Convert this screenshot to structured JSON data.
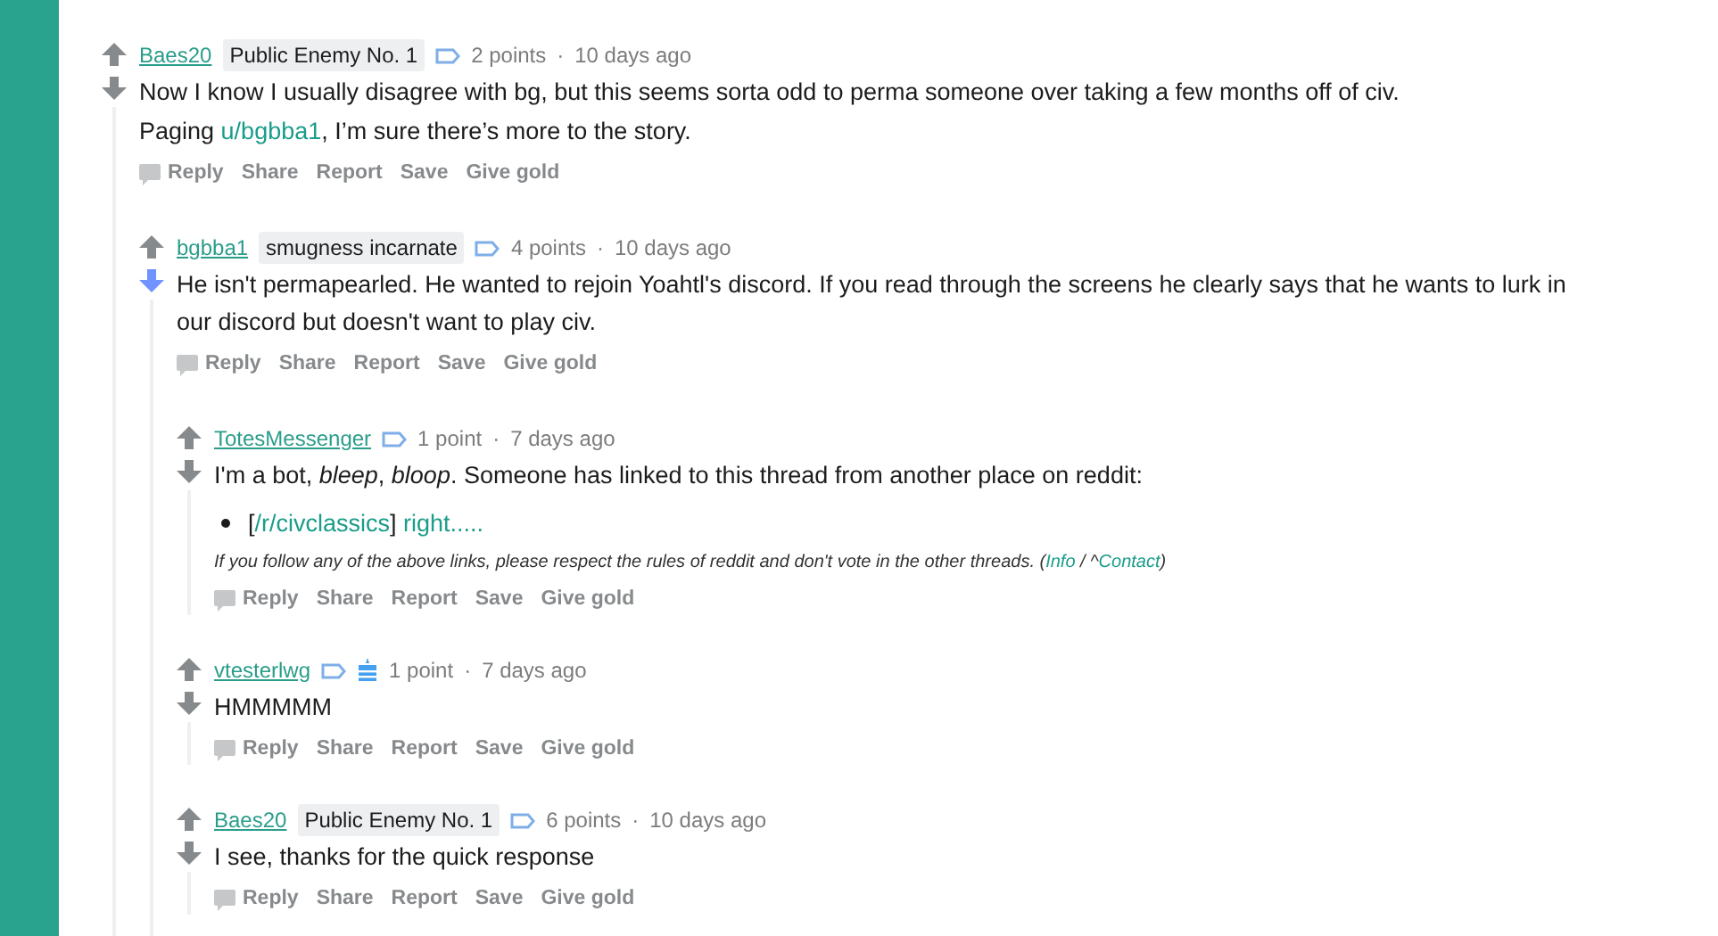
{
  "comments": [
    {
      "author": "Baes20",
      "flair": "Public Enemy No. 1",
      "points": "2 points",
      "separator": "·",
      "time": "10 days ago",
      "upvoted": false,
      "downvoted": false,
      "cake_day": false,
      "body": [
        {
          "kind": "paragraph",
          "parts": [
            {
              "kind": "text",
              "text": "Now I know I usually disagree with bg, but this seems sorta odd to perma someone over taking a few months off of civ."
            }
          ]
        },
        {
          "kind": "paragraph",
          "parts": [
            {
              "kind": "text",
              "text": "Paging "
            },
            {
              "kind": "link",
              "text": "u/bgbba1"
            },
            {
              "kind": "text",
              "text": ", I’m sure there’s more to the story."
            }
          ]
        }
      ],
      "actions": [
        "Reply",
        "Share",
        "Report",
        "Save",
        "Give gold"
      ],
      "children": [
        {
          "author": "bgbba1",
          "flair": "smugness incarnate",
          "points": "4 points",
          "separator": "·",
          "time": "10 days ago",
          "upvoted": false,
          "downvoted": true,
          "cake_day": false,
          "body": [
            {
              "kind": "paragraph",
              "parts": [
                {
                  "kind": "text",
                  "text": "He isn't permapearled. He wanted to rejoin Yoahtl's discord. If you read through the screens he clearly says that he wants to lurk in our discord but doesn't want to play civ."
                }
              ]
            }
          ],
          "actions": [
            "Reply",
            "Share",
            "Report",
            "Save",
            "Give gold"
          ],
          "children": [
            {
              "author": "TotesMessenger",
              "points": "1 point",
              "separator": "·",
              "time": "7 days ago",
              "upvoted": false,
              "downvoted": false,
              "cake_day": false,
              "body": [
                {
                  "kind": "paragraph",
                  "parts": [
                    {
                      "kind": "text",
                      "text": "I'm a bot, *bleep*, *bloop*. Someone has linked to this thread from another place on reddit:"
                    }
                  ]
                },
                {
                  "kind": "bullet",
                  "parts": [
                    {
                      "kind": "text",
                      "text": "["
                    },
                    {
                      "kind": "link",
                      "text": "/r/civclassics"
                    },
                    {
                      "kind": "text",
                      "text": "] "
                    },
                    {
                      "kind": "link",
                      "text": "right....."
                    }
                  ]
                },
                {
                  "kind": "footnote",
                  "parts": [
                    {
                      "kind": "text",
                      "text": "If you follow any of the above links, please respect the rules of reddit and don't vote in the other threads. ("
                    },
                    {
                      "kind": "link",
                      "text": "Info"
                    },
                    {
                      "kind": "text",
                      "text": " / ^"
                    },
                    {
                      "kind": "biglink",
                      "text": "Contact"
                    },
                    {
                      "kind": "text",
                      "text": ")"
                    }
                  ]
                }
              ],
              "actions": [
                "Reply",
                "Share",
                "Report",
                "Save",
                "Give gold"
              ]
            },
            {
              "author": "vtesterlwg",
              "points": "1 point",
              "separator": "·",
              "time": "7 days ago",
              "upvoted": false,
              "downvoted": false,
              "cake_day": true,
              "body": [
                {
                  "kind": "paragraph",
                  "parts": [
                    {
                      "kind": "text",
                      "text": "HMMMMM"
                    }
                  ]
                }
              ],
              "actions": [
                "Reply",
                "Share",
                "Report",
                "Save",
                "Give gold"
              ]
            },
            {
              "author": "Baes20",
              "flair": "Public Enemy No. 1",
              "points": "6 points",
              "separator": "·",
              "time": "10 days ago",
              "upvoted": false,
              "downvoted": false,
              "cake_day": false,
              "body": [
                {
                  "kind": "paragraph",
                  "parts": [
                    {
                      "kind": "text",
                      "text": "I see, thanks for the quick response"
                    }
                  ]
                }
              ],
              "actions": [
                "Reply",
                "Share",
                "Report",
                "Save",
                "Give gold"
              ]
            }
          ]
        }
      ]
    }
  ]
}
